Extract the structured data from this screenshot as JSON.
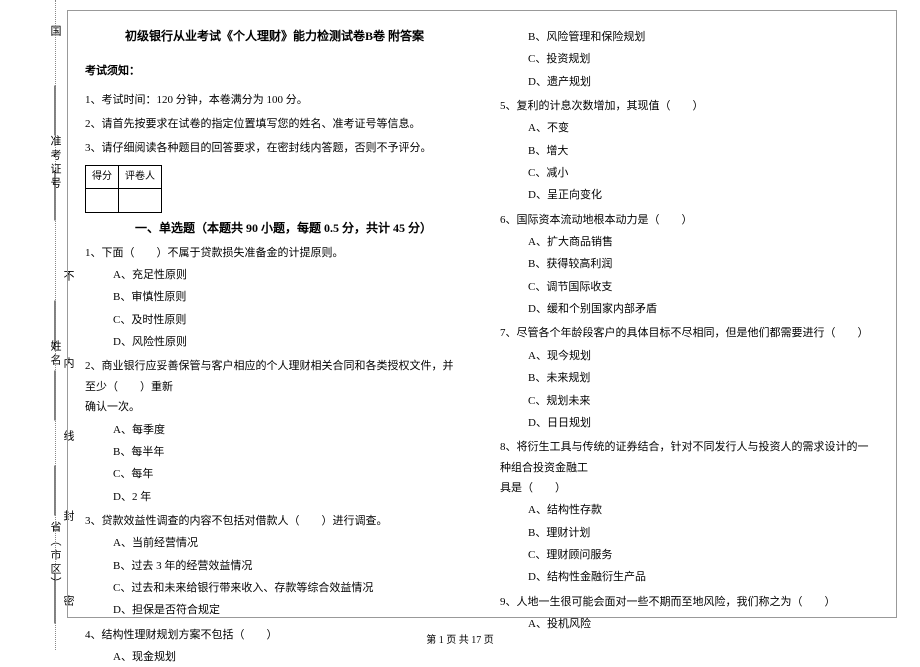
{
  "vertical": {
    "country": "国",
    "zhun": "准考证号",
    "bu": "不",
    "name": "姓名",
    "nei": "内",
    "xian": "线",
    "sheng": "省（市区）",
    "feng": "封",
    "mi": "密"
  },
  "title": "初级银行从业考试《个人理财》能力检测试卷B卷 附答案",
  "notice": {
    "label": "考试须知：",
    "items": [
      "1、考试时间：120 分钟，本卷满分为 100 分。",
      "2、请首先按要求在试卷的指定位置填写您的姓名、准考证号等信息。",
      "3、请仔细阅读各种题目的回答要求，在密封线内答题，否则不予评分。"
    ]
  },
  "scoreTable": {
    "c1": "得分",
    "c2": "评卷人"
  },
  "sectionHead": "一、单选题（本题共 90 小题，每题 0.5 分，共计 45 分）",
  "left": {
    "q1": "1、下面（　　）不属于贷款损失准备金的计提原则。",
    "q1a": "A、充足性原则",
    "q1b": "B、审慎性原则",
    "q1c": "C、及时性原则",
    "q1d": "D、风险性原则",
    "q2a": "2、商业银行应妥善保管与客户相应的个人理财相关合同和各类授权文件，并至少（　　）重新",
    "q2b": "确认一次。",
    "q2oa": "A、每季度",
    "q2ob": "B、每半年",
    "q2oc": "C、每年",
    "q2od": "D、2 年",
    "q3": "3、贷款效益性调查的内容不包括对借款人（　　）进行调查。",
    "q3a": "A、当前经营情况",
    "q3b": "B、过去 3 年的经营效益情况",
    "q3c": "C、过去和未来给银行带来收入、存款等综合效益情况",
    "q3d": "D、担保是否符合规定",
    "q4": "4、结构性理财规划方案不包括（　　）",
    "q4a": "A、现金规划"
  },
  "right": {
    "q4b": "B、风险管理和保险规划",
    "q4c": "C、投资规划",
    "q4d": "D、遗产规划",
    "q5": "5、复利的计息次数增加，其现值（　　）",
    "q5a": "A、不变",
    "q5b": "B、增大",
    "q5c": "C、减小",
    "q5d": "D、呈正向变化",
    "q6": "6、国际资本流动地根本动力是（　　）",
    "q6a": "A、扩大商品销售",
    "q6b": "B、获得较高利润",
    "q6c": "C、调节国际收支",
    "q6d": "D、缓和个别国家内部矛盾",
    "q7": "7、尽管各个年龄段客户的具体目标不尽相同，但是他们都需要进行（　　）",
    "q7a": "A、现今规划",
    "q7b": "B、未来规划",
    "q7c": "C、规划未来",
    "q7d": "D、日日规划",
    "q8a": "8、将衍生工具与传统的证券结合，针对不同发行人与投资人的需求设计的一种组合投资金融工",
    "q8b": "具是（　　）",
    "q8oa": "A、结构性存款",
    "q8ob": "B、理财计划",
    "q8oc": "C、理财顾问服务",
    "q8od": "D、结构性金融衍生产品",
    "q9": "9、人地一生很可能会面对一些不期而至地风险，我们称之为（　　）",
    "q9a": "A、投机风险"
  },
  "pagenum": "第 1 页 共 17 页"
}
